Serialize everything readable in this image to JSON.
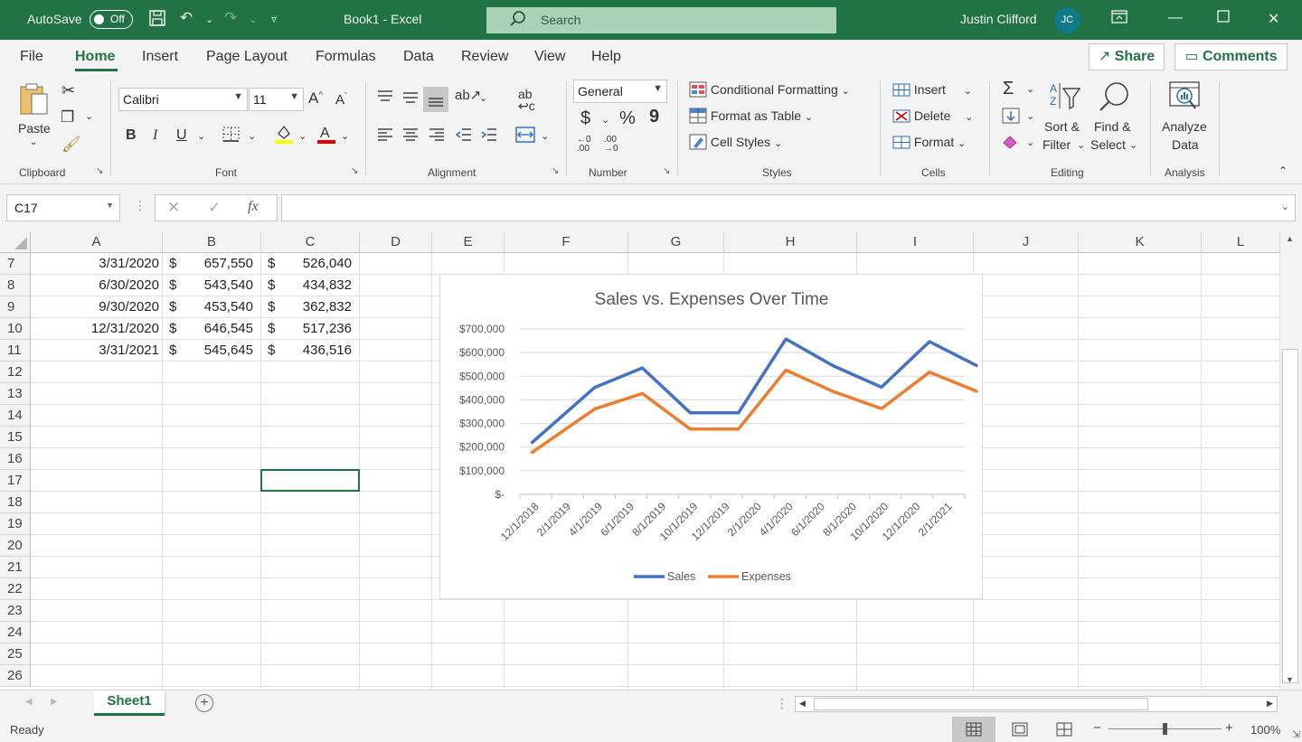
{
  "titlebar": {
    "autosave_label": "AutoSave",
    "autosave_state": "Off",
    "doc_title": "Book1  -  Excel",
    "search_placeholder": "Search",
    "user_name": "Justin Clifford",
    "user_initials": "JC"
  },
  "tabs": [
    "File",
    "Home",
    "Insert",
    "Page Layout",
    "Formulas",
    "Data",
    "Review",
    "View",
    "Help"
  ],
  "active_tab": "Home",
  "share_label": "Share",
  "comments_label": "Comments",
  "ribbon": {
    "clipboard": {
      "paste": "Paste",
      "label": "Clipboard"
    },
    "font": {
      "name": "Calibri",
      "size": "11",
      "bold": "B",
      "italic": "I",
      "underline": "U",
      "label": "Font"
    },
    "alignment": {
      "label": "Alignment"
    },
    "number": {
      "format": "General",
      "currency": "$",
      "percent": "%",
      "comma": "9",
      "label": "Number"
    },
    "styles": {
      "conditional": "Conditional Formatting",
      "format_table": "Format as Table",
      "cell_styles": "Cell Styles",
      "label": "Styles"
    },
    "cells": {
      "insert": "Insert",
      "delete": "Delete",
      "format": "Format",
      "label": "Cells"
    },
    "editing": {
      "sort_line1": "Sort &",
      "sort_line2": "Filter",
      "find_line1": "Find &",
      "find_line2": "Select",
      "label": "Editing"
    },
    "analysis": {
      "line1": "Analyze",
      "line2": "Data",
      "label": "Analysis"
    }
  },
  "formula_bar": {
    "name_box": "C17",
    "formula": ""
  },
  "columns": [
    "A",
    "B",
    "C",
    "D",
    "E",
    "F",
    "G",
    "H",
    "I",
    "J",
    "K",
    "L"
  ],
  "rows": [
    "7",
    "8",
    "9",
    "10",
    "11",
    "12",
    "13",
    "14",
    "15",
    "16",
    "17",
    "18",
    "19",
    "20",
    "21",
    "22",
    "23",
    "24",
    "25",
    "26"
  ],
  "data_rows": [
    {
      "date": "3/31/2020",
      "sales": "657,550",
      "expenses": "526,040"
    },
    {
      "date": "6/30/2020",
      "sales": "543,540",
      "expenses": "434,832"
    },
    {
      "date": "9/30/2020",
      "sales": "453,540",
      "expenses": "362,832"
    },
    {
      "date": "12/31/2020",
      "sales": "646,545",
      "expenses": "517,236"
    },
    {
      "date": "3/31/2021",
      "sales": "545,645",
      "expenses": "436,516"
    }
  ],
  "currency_symbol": "$",
  "chart_data": {
    "type": "line",
    "title": "Sales vs. Expenses Over Time",
    "x": [
      "12/1/2018",
      "3/31/2019",
      "6/30/2019",
      "9/30/2019",
      "12/31/2019",
      "3/31/2020",
      "6/30/2020",
      "9/30/2020",
      "12/31/2020",
      "3/31/2021"
    ],
    "x_tick_labels": [
      "12/1/2018",
      "2/1/2019",
      "4/1/2019",
      "6/1/2019",
      "8/1/2019",
      "10/1/2019",
      "12/1/2019",
      "2/1/2020",
      "4/1/2020",
      "6/1/2020",
      "8/1/2020",
      "10/1/2020",
      "12/1/2020",
      "2/1/2021"
    ],
    "y_tick_labels": [
      "$-",
      "$100,000",
      "$200,000",
      "$300,000",
      "$400,000",
      "$500,000",
      "$600,000",
      "$700,000"
    ],
    "ylim": [
      0,
      700000
    ],
    "series": [
      {
        "name": "Sales",
        "color": "#4472C4",
        "values": [
          220000,
          453000,
          535000,
          345000,
          345000,
          657550,
          543540,
          453540,
          646545,
          545645
        ]
      },
      {
        "name": "Expenses",
        "color": "#ED7D31",
        "values": [
          178000,
          362000,
          427000,
          276000,
          276000,
          526040,
          434832,
          362832,
          517236,
          436516
        ]
      }
    ],
    "legend": "bottom",
    "grid": true
  },
  "sheet_tab": "Sheet1",
  "status": {
    "text": "Ready",
    "zoom": "100%"
  },
  "colors": {
    "accent": "#217346"
  }
}
